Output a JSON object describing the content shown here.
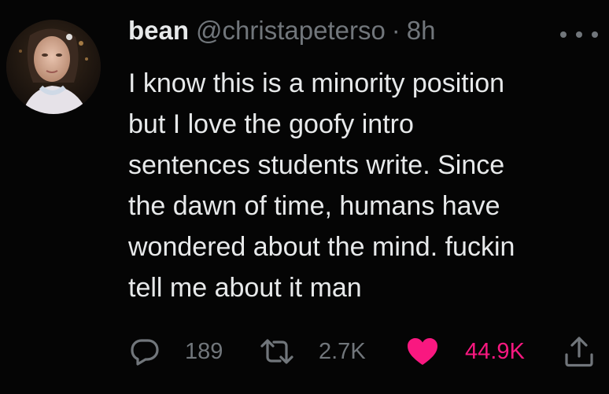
{
  "author": {
    "display_name": "bean",
    "handle": "@christapeterso",
    "separator": "·",
    "timestamp": "8h",
    "avatar_icon": "profile-photo"
  },
  "tweet": {
    "text": "I know this is a minority position\nbut I love the goofy intro\nsentences students write. Since\nthe dawn of time, humans have\nwondered about the mind. fuckin\ntell me about it man"
  },
  "actions": {
    "reply": {
      "icon": "reply-icon",
      "count": "189"
    },
    "retweet": {
      "icon": "retweet-icon",
      "count": "2.7K"
    },
    "like": {
      "icon": "heart-icon",
      "count": "44.9K",
      "liked": true,
      "color": "#f91880"
    },
    "share": {
      "icon": "share-icon"
    }
  },
  "more_menu": {
    "icon": "more-icon"
  },
  "colors": {
    "background": "#050505",
    "primary_text": "#e7e9ea",
    "secondary_text": "#71767b",
    "like_accent": "#f91880"
  }
}
